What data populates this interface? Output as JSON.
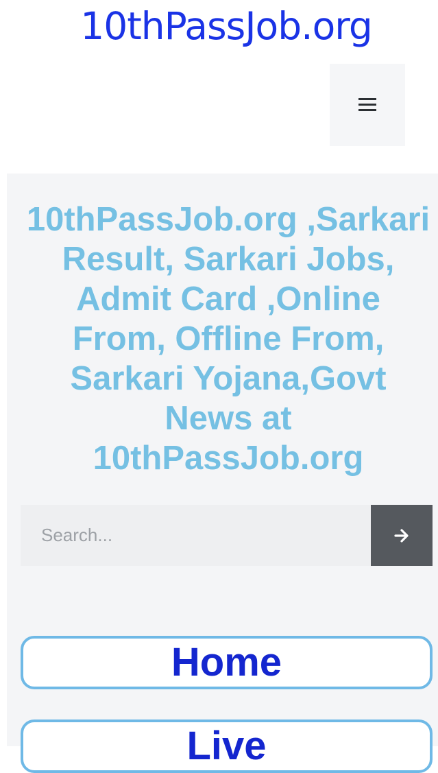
{
  "header": {
    "logo_text": "10thPassJob.org",
    "menu_icon": "hamburger-menu-icon"
  },
  "sidebar": {
    "site_title": "10thPassJob.org ,Sarkari Result, Sarkari Jobs, Admit Card ,Online From, Offline From, Sarkari Yojana,Govt News at 10thPassJob.org",
    "search": {
      "placeholder": "Search...",
      "value": "",
      "submit_icon": "arrow-right-icon"
    },
    "nav": [
      {
        "label": "Home"
      },
      {
        "label": "Live"
      }
    ]
  },
  "colors": {
    "logo": "#1a33e6",
    "title": "#75c0e3",
    "nav_text": "#1426cf",
    "nav_border": "#6fb9e6",
    "search_button": "#55595e"
  }
}
